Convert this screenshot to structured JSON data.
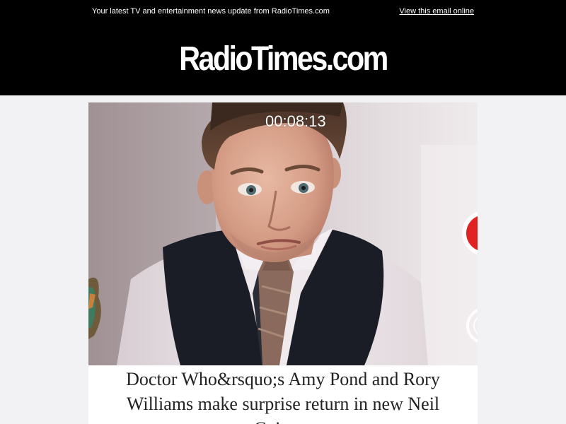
{
  "header": {
    "preheader_text": "Your latest TV and entertainment news update from RadioTimes.com",
    "view_online_label": "View this email online",
    "logo_text": "RadioTimes.com",
    "background_color": "#000000"
  },
  "article": {
    "video_timestamp": "00:08:13",
    "headline": "Doctor Who&rsquo;s Amy Pond and Rory Williams make surprise return in new Neil Gaiman",
    "headline_color": "#222222"
  },
  "page": {
    "background_color": "#f2f2f4"
  }
}
